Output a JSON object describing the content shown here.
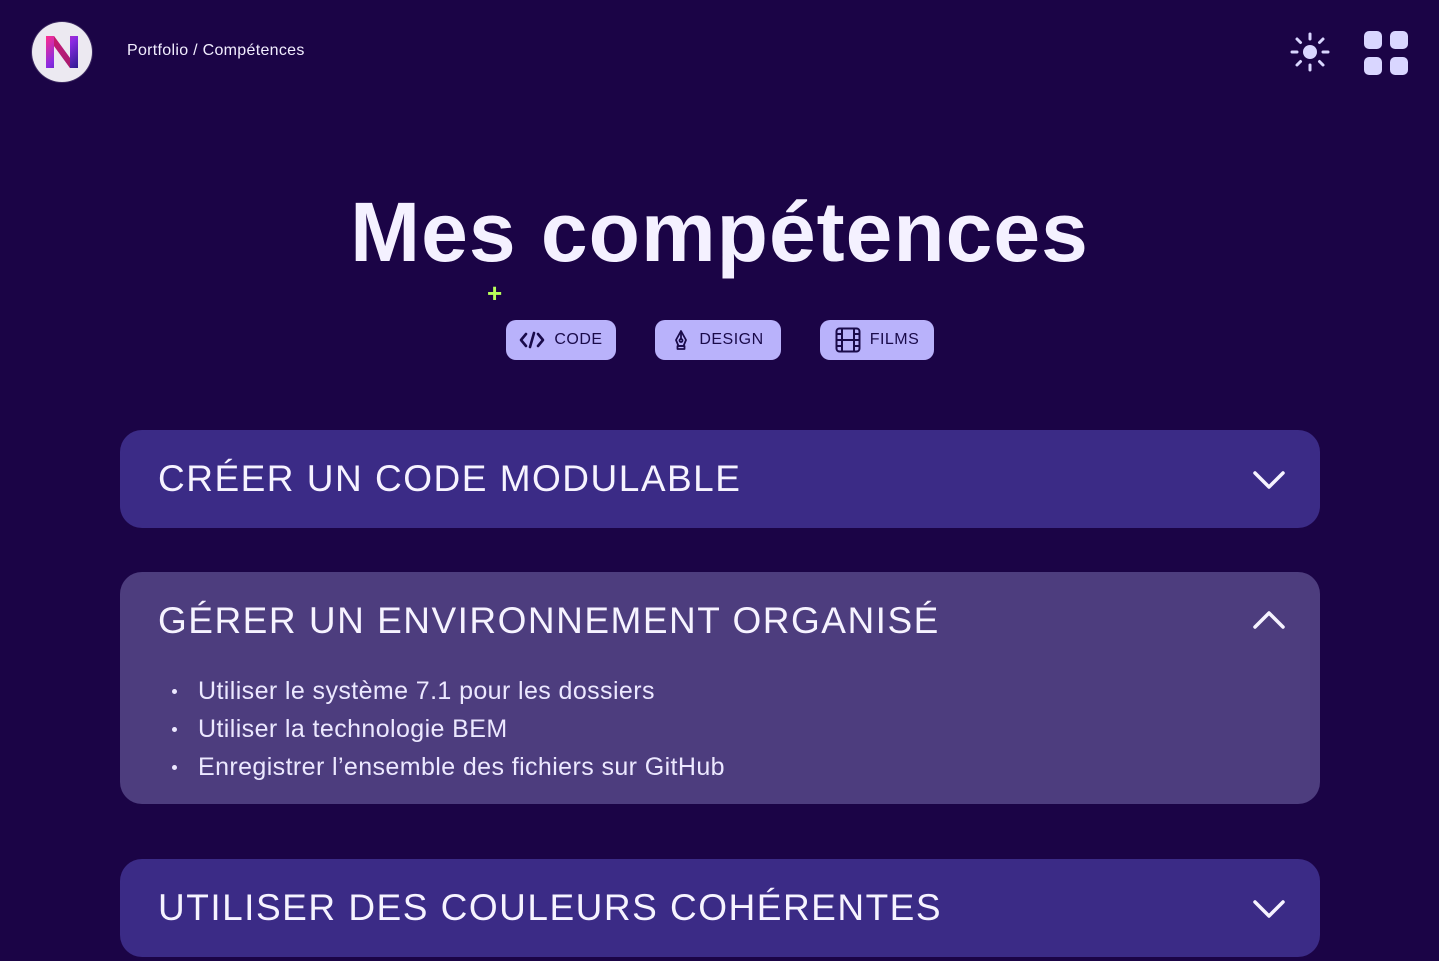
{
  "header": {
    "breadcrumb": "Portfolio / Compétences",
    "logo_icon": "n-logo-icon",
    "theme_icon": "sun-icon",
    "menu_icon": "grid-menu-icon"
  },
  "main": {
    "title": "Mes compétences",
    "filters": [
      {
        "label": "CODE",
        "icon": "code-icon"
      },
      {
        "label": "DESIGN",
        "icon": "pen-nib-icon"
      },
      {
        "label": "FILMS",
        "icon": "film-icon"
      }
    ],
    "accordions": [
      {
        "title": "CRÉER UN CODE MODULABLE",
        "expanded": false,
        "items": []
      },
      {
        "title": "GÉRER UN ENVIRONNEMENT ORGANISÉ",
        "expanded": true,
        "items": [
          "Utiliser le système 7.1 pour les dossiers",
          "Utiliser la technologie BEM",
          "Enregistrer l’ensemble des fichiers sur GitHub"
        ]
      },
      {
        "title": "UTILISER DES COULEURS COHÉRENTES",
        "expanded": false,
        "items": []
      }
    ]
  },
  "colors": {
    "background": "#1b0446",
    "accordion_closed": "#3b2b86",
    "accordion_open": "#4d3d7e",
    "filter_button": "#b9b2fb",
    "cursor_accent": "#b8ff5a"
  }
}
